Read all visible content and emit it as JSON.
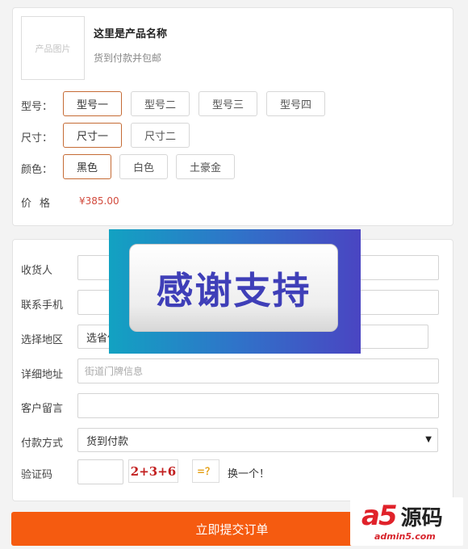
{
  "product": {
    "thumb_text": "产品图片",
    "name": "这里是产品名称",
    "subtitle": "货到付款并包邮"
  },
  "options": {
    "model": {
      "label": "型号：",
      "items": [
        "型号一",
        "型号二",
        "型号三",
        "型号四"
      ],
      "selected": 0
    },
    "size": {
      "label": "尺寸：",
      "items": [
        "尺寸一",
        "尺寸二"
      ],
      "selected": 0
    },
    "color": {
      "label": "颜色：",
      "items": [
        "黑色",
        "白色",
        "土豪金"
      ],
      "selected": 0
    }
  },
  "price": {
    "label": "价格",
    "value": "¥385.00"
  },
  "form": {
    "recipient": {
      "label": "收货人",
      "value": ""
    },
    "phone": {
      "label": "联系手机",
      "value": ""
    },
    "region": {
      "label": "选择地区",
      "value": "选省份"
    },
    "address": {
      "label": "详细地址",
      "placeholder": "街道门牌信息"
    },
    "message": {
      "label": "客户留言",
      "value": ""
    },
    "payment": {
      "label": "付款方式",
      "value": "货到付款"
    },
    "captcha": {
      "label": "验证码",
      "value": "",
      "expression": "2+3+6",
      "equals": "=？",
      "refresh": "换一个！"
    }
  },
  "submit_label": "立即提交订单",
  "overlay_text": "感谢支持",
  "watermark": {
    "a": "a",
    "five": "5",
    "cn": "源码",
    "url": "admin5.com"
  },
  "colors": {
    "accent": "#f55b10",
    "selected_border": "#c56b35",
    "price": "#d24a3d",
    "banner_text": "#3f3fb8"
  }
}
